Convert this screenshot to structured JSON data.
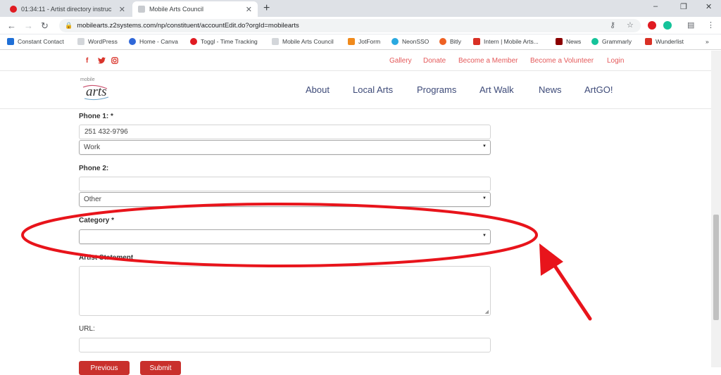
{
  "browser": {
    "tabs": [
      {
        "title": "01:34:11 - Artist directory instruc",
        "icon": "toggl-icon",
        "color": "#e01b22"
      },
      {
        "title": "Mobile Arts Council",
        "icon": "site-favicon",
        "color": "#9aa0a6"
      }
    ],
    "new_tab": "+",
    "window_controls": [
      "–",
      "❐",
      "✕"
    ],
    "url": "mobilearts.z2systems.com/np/constituent/accountEdit.do?orgId=mobilearts",
    "bookmarks": [
      {
        "label": "Constant Contact",
        "icon": "constant-contact-icon",
        "color": "#1f6fd6"
      },
      {
        "label": "WordPress",
        "icon": "bookmark-page-icon",
        "color": "#9aa0a6"
      },
      {
        "label": "Home - Canva",
        "icon": "canva-icon",
        "color": "#2f67d8"
      },
      {
        "label": "Toggl - Time Tracking",
        "icon": "toggl-icon",
        "color": "#e01b22"
      },
      {
        "label": "Mobile Arts Council",
        "icon": "bookmark-page-icon",
        "color": "#9aa0a6"
      },
      {
        "label": "JotForm",
        "icon": "jotform-icon",
        "color": "#f08a1c"
      },
      {
        "label": "NeonSSO",
        "icon": "neon-icon",
        "color": "#29a9e0"
      },
      {
        "label": "Bitly",
        "icon": "bitly-icon",
        "color": "#ee6123"
      },
      {
        "label": "Intern | Mobile Arts...",
        "icon": "intern-icon",
        "color": "#d93025"
      },
      {
        "label": "News",
        "icon": "news-icon",
        "color": "#8b0000"
      },
      {
        "label": "Grammarly",
        "icon": "grammarly-icon",
        "color": "#15c39a"
      },
      {
        "label": "Wunderlist",
        "icon": "wunderlist-icon",
        "color": "#d93025"
      }
    ],
    "overflow": "»"
  },
  "site": {
    "social": [
      "f",
      "🐦",
      "◎"
    ],
    "top_links": [
      "Gallery",
      "Donate",
      "Become a Member",
      "Become a Volunteer",
      "Login"
    ],
    "logo_text": "arts",
    "nav": [
      "About",
      "Local Arts",
      "Programs",
      "Art Walk",
      "News",
      "ArtGO!"
    ]
  },
  "form": {
    "phone1_label": "Phone 1: *",
    "phone1_value": "251 432-9796",
    "phone1_type": "Work",
    "phone2_label": "Phone 2:",
    "phone2_value": "",
    "phone2_type": "Other",
    "category_label": "Category *",
    "category_value": "",
    "statement_label": "Artist Statement",
    "url_label": "URL:",
    "url_value": "",
    "previous_button": "Previous",
    "submit_button": "Submit"
  },
  "colors": {
    "accent": "#c9302c",
    "nav_text": "#3d4a78",
    "annotation": "#e8141b"
  }
}
